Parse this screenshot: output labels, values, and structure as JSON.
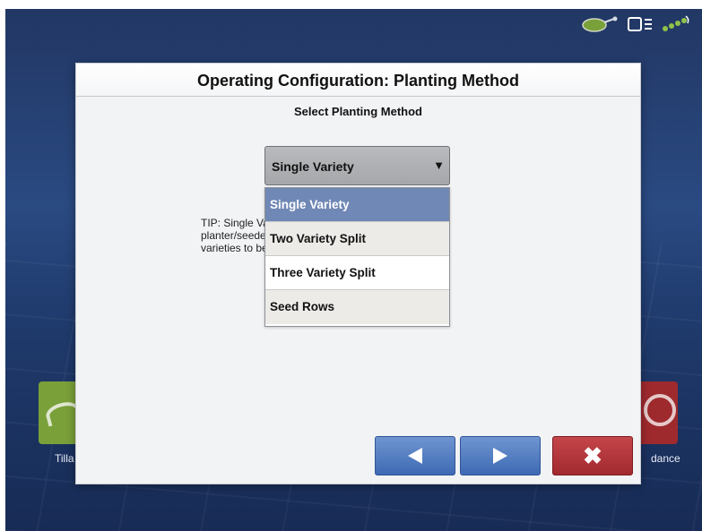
{
  "dialog": {
    "title": "Operating Configuration: Planting Method",
    "subtitle": "Select Planting Method",
    "select": {
      "value": "Single Variety",
      "arrow": "▼"
    },
    "tip_lines": [
      "TIP: Single Variety should be used if the entire",
      "planter/seeder is planting one, two or three",
      "varieties to be planted simultaneously."
    ],
    "options": [
      {
        "label": "Single Variety",
        "state": "selected"
      },
      {
        "label": "Two Variety Split",
        "state": "normal"
      },
      {
        "label": "Three Variety Split",
        "state": "hover"
      },
      {
        "label": "Seed Rows",
        "state": "normal"
      }
    ],
    "buttons": {
      "cancel": "✖"
    }
  },
  "background": {
    "tile_left_label": "Tilla",
    "tile_right_label": "dance"
  },
  "status_icons": [
    "implement-icon",
    "display-icon",
    "gps-signal-icon"
  ],
  "colors": {
    "selected_option": "#7088b5",
    "nav_button": "#4a77bf",
    "cancel_button": "#b33a3f",
    "screen_bg": "#223764"
  }
}
